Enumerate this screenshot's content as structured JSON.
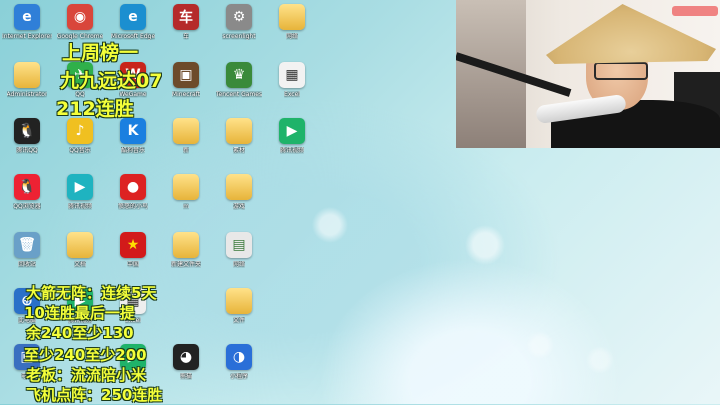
{
  "desktop": {
    "icons": [
      {
        "label": "Internet Explorer",
        "glyph": "e",
        "color": "#2f7fd8"
      },
      {
        "label": "Google Chrome",
        "glyph": "◉",
        "color": "#d9463b"
      },
      {
        "label": "Microsoft Edge",
        "glyph": "e",
        "color": "#1b8fd0"
      },
      {
        "label": "车",
        "glyph": "车",
        "color": "#b52a2a"
      },
      {
        "label": "screenlight",
        "glyph": "⚙",
        "color": "#8a8a8a"
      },
      {
        "label": "网络",
        "glyph": "",
        "color": "folder"
      },
      {
        "label": "Administrator",
        "glyph": "",
        "color": "folder"
      },
      {
        "label": "QQ",
        "glyph": "✈",
        "color": "#2fb04a"
      },
      {
        "label": "WeGame",
        "glyph": "W",
        "color": "#c8241b"
      },
      {
        "label": "Minecraft",
        "glyph": "▣",
        "color": "#6d4b2a"
      },
      {
        "label": "Tencent Games",
        "glyph": "♛",
        "color": "#3a8a3a"
      },
      {
        "label": "Excel",
        "glyph": "▦",
        "color": "#f2f2f2"
      },
      {
        "label": "腾讯QQ",
        "glyph": "🐧",
        "color": "#222"
      },
      {
        "label": "QQ音乐",
        "glyph": "♪",
        "color": "#f0c020"
      },
      {
        "label": "酷狗音乐",
        "glyph": "K",
        "color": "#1a7fe0"
      },
      {
        "label": "新",
        "glyph": "",
        "color": "folder"
      },
      {
        "label": "素材",
        "glyph": "",
        "color": "folder"
      },
      {
        "label": "腾讯视频",
        "glyph": "▶",
        "color": "#1fb36a"
      },
      {
        "label": "QQ浏览器",
        "glyph": "🐧",
        "color": "#e23"
      },
      {
        "label": "腾讯视频",
        "glyph": "▶",
        "color": "#1fb3c0"
      },
      {
        "label": "愤怒的小鸟",
        "glyph": "●",
        "color": "#d22"
      },
      {
        "label": "m",
        "glyph": "",
        "color": "folder"
      },
      {
        "label": "游戏",
        "glyph": "",
        "color": "folder"
      },
      {
        "label": "回收站",
        "glyph": "🗑",
        "color": "#6aa0c8"
      },
      {
        "label": "文档",
        "glyph": "",
        "color": "folder"
      },
      {
        "label": "中国",
        "glyph": "★",
        "color": "#d21a1a"
      },
      {
        "label": "新建文件夹",
        "glyph": "",
        "color": "folder"
      },
      {
        "label": "网络",
        "glyph": "▤",
        "color": "#e8e8e8"
      },
      {
        "label": "此电脑",
        "glyph": "⊕",
        "color": "#2a70c8"
      },
      {
        "label": "腾讯视频",
        "glyph": "▶",
        "color": "#1fb36a"
      },
      {
        "label": "Excel",
        "glyph": "▦",
        "color": "#eee"
      },
      {
        "label": "文件",
        "glyph": "",
        "color": "folder"
      },
      {
        "label": "电脑",
        "glyph": "▣",
        "color": "#3a6fc0"
      },
      {
        "label": "视频",
        "glyph": "▶",
        "color": "#1fb36a"
      },
      {
        "label": "熊猫",
        "glyph": "◕",
        "color": "#222"
      },
      {
        "label": "小程序",
        "glyph": "◑",
        "color": "#2a6fd8"
      }
    ]
  },
  "overlay": {
    "lines": [
      "上周榜一",
      "九九远达07",
      "212连胜",
      "大箭无阵：连续5天",
      "10连胜最后一提",
      "余240至少130",
      "至少240至少200",
      "老板：流流陪小米",
      "飞机点阵：250连胜"
    ]
  },
  "webcam": {
    "label": "webcam-feed"
  }
}
